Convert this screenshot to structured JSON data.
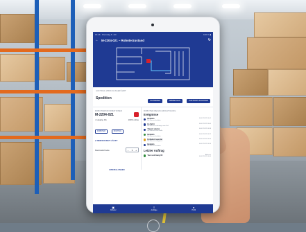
{
  "status_bar": {
    "left": "16:46 · Dienstag 6. Juli",
    "right": "100 % ▮"
  },
  "app_bar": {
    "back_icon": "arrow-left-icon",
    "title": "M-2204-021 – Roboterzustand",
    "refresh_icon": "refresh-icon"
  },
  "job": {
    "caption": "AUFTRAG WIRD AUSGEFÜHRT",
    "name": "Spedition",
    "actions": [
      "PAUSIEREN",
      "ABBRECHEN",
      "ZUR BASIS SCHICKEN"
    ]
  },
  "robot": {
    "caption": "ROBOTERINFORMATIONEN",
    "id": "M-2204-021",
    "location": "Hauptg. 0G",
    "battery": "100%",
    "mode": "online",
    "tags": [
      "ROBOTER",
      "ROUTING"
    ],
    "loop_label": "WEBSOCKET LÄUFT",
    "speed_label": "Maximalschnelle",
    "speed_value": "3",
    "settings_link": "EINSTELLUNGEN"
  },
  "events": {
    "caption": "ROBOTER-BENACHRICHTIGUNG",
    "title": "Ereignisse",
    "items": [
      {
        "title": "Beladen",
        "sub": "Mit Wasser beladen",
        "time": "06.07.2022 16:41",
        "color": "#1f3a93"
      },
      {
        "title": "Im Fahrt",
        "sub": "Mit Wasser unterwegs zum Ziel",
        "time": "06.07.2022 16:40",
        "color": "#1f3a93"
      },
      {
        "title": "Transit starten",
        "sub": "Mit Wasser nach Halle",
        "time": "06.07.2022 16:38",
        "color": "#1f3a93"
      },
      {
        "title": "Beladen",
        "sub": "Mit Wasser beladen",
        "time": "06.07.2022 16:37",
        "color": "#2e8b3a"
      },
      {
        "title": "Entladen beendet",
        "sub": "Mit Wasser erfolgreich",
        "time": "06.07.2022 16:35",
        "color": "#e0a020"
      },
      {
        "title": "Beladen",
        "sub": "Mit Wasser beladen",
        "time": "06.07.2022 16:34",
        "color": "#1f3a93"
      }
    ]
  },
  "last_job": {
    "title": "Letzter Auftrag",
    "item_title": "Tuer und Gang 06",
    "item_status": "Abbruch",
    "item_time": "06.07.2022 16:30"
  },
  "bottom_nav": [
    {
      "icon": "robot-icon",
      "label": "Roboter"
    },
    {
      "icon": "list-icon",
      "label": "Aufträge"
    },
    {
      "icon": "user-icon",
      "label": "Profil"
    }
  ]
}
